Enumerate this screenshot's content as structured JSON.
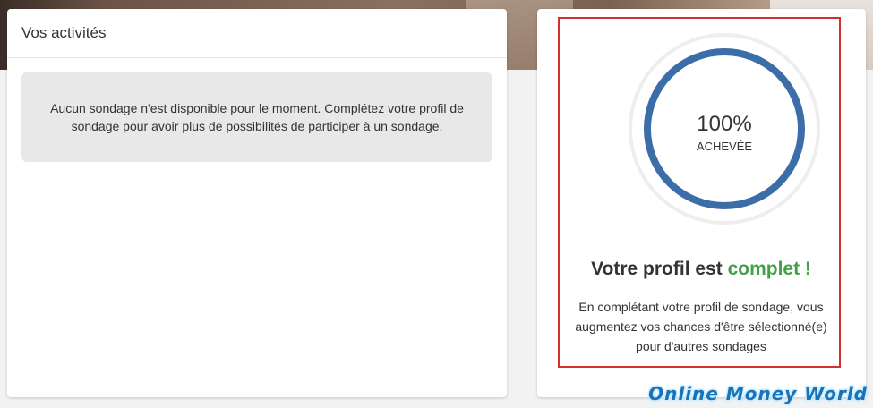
{
  "activities": {
    "title": "Vos activités",
    "empty_message": "Aucun sondage n'est disponible pour le moment. Complétez votre profil de sondage pour avoir plus de possibilités de participer à un sondage."
  },
  "profile": {
    "progress_percent": 100,
    "progress_label": "100%",
    "progress_caption": "ACHEVÉE",
    "title_prefix": "Votre profil est",
    "title_highlight": "complet !",
    "description": "En complétant votre profil de sondage, vous augmentez vos chances d'être sélectionné(e) pour d'autres sondages"
  },
  "watermark": "Online Money World",
  "colors": {
    "progress_ring": "#3b6ea8",
    "complete_green": "#43a047",
    "highlight_border": "#d32f2f"
  }
}
